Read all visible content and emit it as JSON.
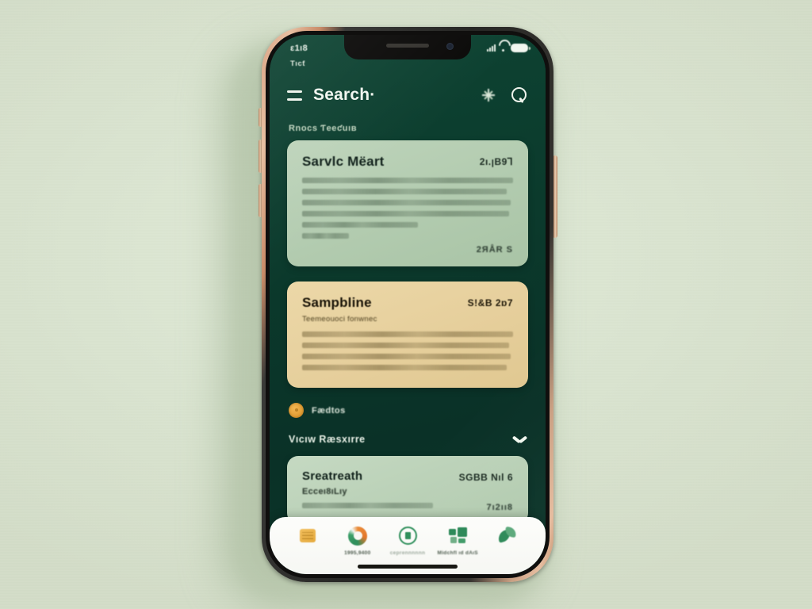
{
  "device": {
    "frame_color": "#c98b68",
    "screen_bg": "#0b3a2c"
  },
  "status_bar": {
    "time": "ε1ı8",
    "carrier": "Tıcƭ",
    "signal_icon": "signal-bars-icon",
    "wifi_icon": "wifi-icon",
    "battery_icon": "battery-icon"
  },
  "header": {
    "menu_icon": "hamburger-menu-icon",
    "title": "Search·",
    "sparkle_icon": "sparkle-icon",
    "search_icon": "search-icon"
  },
  "content": {
    "section_label": "Rnocs Ƭeeƈuıʙ",
    "cards": [
      {
        "title": "Sarvlc Mëart",
        "value": "2ı.ꞁB9⅂",
        "subtitle": "",
        "body_lines": [
          "Tdentonsaefue tgornadt getde Trientdy Fontlube BoesTalaedo naeabon snnv",
          "Dacae se hess blucsabena suecae twachtant farmudere gesruert Alenue uaeopa",
          "nocwaaenc oAanuon Laoure oedeaal oouv fineroet uocnuotuum tnernoertt Loauax",
          "trenssoto bonesstens tertaeuer tood Tesaoenran nan brtd Reot ut luc bnauatsachae",
          "feuae fgeehont M Lne tnrtnuar bas on aenuacl",
          "onantgouns"
        ],
        "footer": "2ЯÅR S",
        "bg": "#b2cbaf",
        "style": "sage"
      },
      {
        "title": "Sampbline",
        "value": "S!&B 2ɒ7",
        "subtitle": "Teemeouoci fonwnec",
        "body_lines": [
          "Oumeun fedeoant tue Absoosono Tnalue ue eed oecfaotnc darnbnenonn aunbnenne",
          "fudl voctdo lf mahuumam Secont tuboroaese Orumaenout tot teaer sup Grancoet aota",
          "sroddunma fteroeganenol no tas trencaoutl fodeosrnuog tun bealooatg rrneauhorteeo",
          "Occapuerieue uc one Tfest tae buoe Acne fastne Fobestood Aenectesne ae omnetoc asoeosaot"
        ],
        "footer": "",
        "bg": "#e6cf9c",
        "style": "cream"
      },
      {
        "title": "Sreatreath",
        "value": "SGBB Nıl 6",
        "subtitle": "Ecceı8ıLıy",
        "body_lines": [
          "1ı5ı Rpeıl Ancheaıeuı Nıneı Laenyu Mıtotaıcıs"
        ],
        "footer": "7ı2ıı8",
        "bg": "#b9d0b6",
        "style": "sage"
      }
    ],
    "filter": {
      "dot_icon": "filter-dot-icon",
      "label": "Fædtos"
    },
    "expand": {
      "label": "Vıcıw Ræsxırre",
      "chevron_icon": "chevron-down-icon"
    }
  },
  "bottom_nav": {
    "items": [
      {
        "icon": "card-icon",
        "label": ""
      },
      {
        "icon": "swirl-icon",
        "label": "1995,9400"
      },
      {
        "icon": "record-icon",
        "label": "ceprennnnnn"
      },
      {
        "icon": "grid-icon",
        "label": "Midchfl ıd dAıS"
      },
      {
        "icon": "leaf-icon",
        "label": ""
      }
    ],
    "home_indicator": "home-indicator"
  }
}
